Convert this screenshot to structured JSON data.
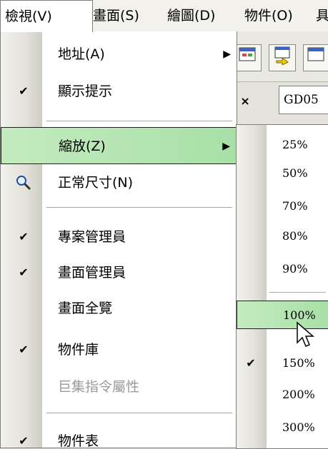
{
  "menubar": {
    "items": [
      {
        "label": "檢視(V)"
      },
      {
        "label": "畫面(S)"
      },
      {
        "label": "繪圖(D)"
      },
      {
        "label": "物件(O)"
      },
      {
        "label": "具"
      }
    ]
  },
  "toolbar": {
    "icons": [
      "window-icon",
      "window-arrow-icon",
      "window-icon"
    ]
  },
  "document": {
    "close_glyph": "▫ ×",
    "tab_label": "GD05"
  },
  "view_menu": {
    "items": [
      {
        "label": "地址(A)",
        "submenu": true
      },
      {
        "label": "顯示提示",
        "checked": true
      },
      {
        "label": "縮放(Z)",
        "submenu": true,
        "highlighted": true
      },
      {
        "label": "正常尺寸(N)",
        "icon": "magnifier-icon"
      },
      {
        "label": "專案管理員",
        "checked": true
      },
      {
        "label": "畫面管理員",
        "checked": true
      },
      {
        "label": "畫面全覽"
      },
      {
        "label": "物件庫",
        "checked": true
      },
      {
        "label": "巨集指令屬性",
        "disabled": true
      },
      {
        "label": "物件表",
        "checked": true
      }
    ]
  },
  "zoom_submenu": {
    "items": [
      {
        "label": "25%"
      },
      {
        "label": "50%"
      },
      {
        "label": "70%"
      },
      {
        "label": "80%"
      },
      {
        "label": "90%"
      },
      {
        "label": "100%",
        "highlighted": true
      },
      {
        "label": "150%",
        "checked": true
      },
      {
        "label": "200%"
      },
      {
        "label": "300%"
      }
    ]
  },
  "glyphs": {
    "check": "✔",
    "arrow": "▶",
    "magnifier": "🔍"
  },
  "colors": {
    "highlight_start": "#c4ebc0",
    "highlight_end": "#a8e0a6",
    "disabled_text": "#9a9a9a"
  }
}
